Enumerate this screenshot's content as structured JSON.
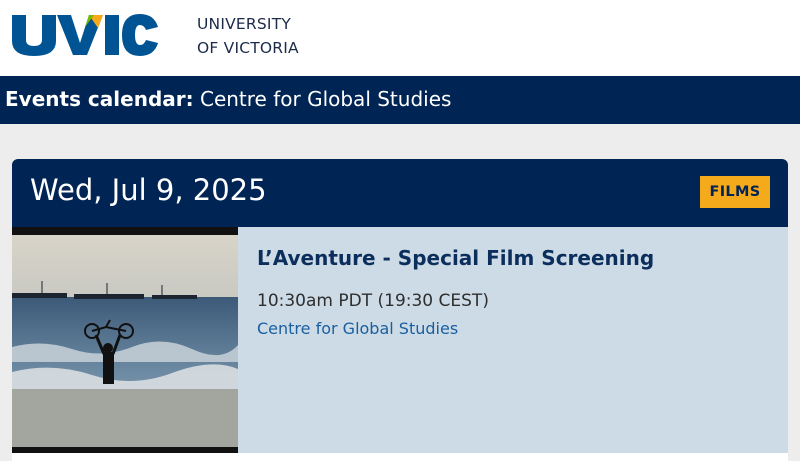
{
  "header": {
    "logo_text": "UVIC",
    "university_line1": "UNIVERSITY",
    "university_line2": "OF VICTORIA",
    "colors": {
      "navy": "#002454",
      "blue": "#005493",
      "green": "#7ab800",
      "gold": "#f5aa1c"
    }
  },
  "title_bar": {
    "label": "Events calendar:",
    "title": "Centre for Global Studies"
  },
  "event": {
    "date": "Wed, Jul 9, 2025",
    "category": "FILMS",
    "title": "L’Aventure - Special Film Screening",
    "time": "10:30am PDT (19:30 CEST)",
    "organizer": "Centre for Global Studies",
    "image_icon": "beach-cyclist-photo"
  }
}
